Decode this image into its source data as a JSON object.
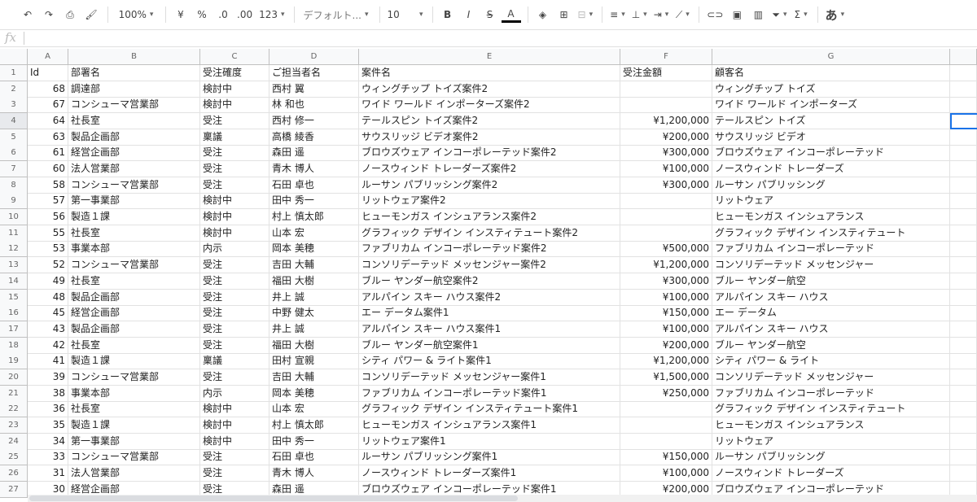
{
  "toolbar": {
    "zoom": "100%",
    "currency": "¥",
    "percent": "%",
    "dec_less": ".0",
    "dec_more": ".00",
    "format": "123",
    "font": "デフォルト...",
    "size": "10",
    "bold": "B",
    "italic": "I",
    "strike": "S",
    "textcolor": "A",
    "ime": "あ",
    "sum": "Σ"
  },
  "formula": {
    "fx": "fx",
    "value": ""
  },
  "columns": [
    "A",
    "B",
    "C",
    "D",
    "E",
    "F",
    "G",
    ""
  ],
  "header": [
    "Id",
    "部署名",
    "受注確度",
    "ご担当者名",
    "案件名",
    "受注金額",
    "顧客名"
  ],
  "rows": [
    [
      "68",
      "調達部",
      "検討中",
      "西村 翼",
      "ウィングチップ トイズ案件2",
      "",
      "ウィングチップ トイズ"
    ],
    [
      "67",
      "コンシューマ営業部",
      "検討中",
      "林 和也",
      "ワイド ワールド インポーターズ案件2",
      "",
      "ワイド ワールド インポーターズ"
    ],
    [
      "64",
      "社長室",
      "受注",
      "西村 修一",
      "テールスピン トイズ案件2",
      "¥1,200,000",
      "テールスピン トイズ"
    ],
    [
      "63",
      "製品企画部",
      "稟議",
      "高橋 綾香",
      "サウスリッジ ビデオ案件2",
      "¥200,000",
      "サウスリッジ ビデオ"
    ],
    [
      "61",
      "経営企画部",
      "受注",
      "森田 遥",
      "ブロウズウェア インコーポレーテッド案件2",
      "¥300,000",
      "ブロウズウェア インコーポレーテッド"
    ],
    [
      "60",
      "法人営業部",
      "受注",
      "青木 博人",
      "ノースウィンド トレーダーズ案件2",
      "¥100,000",
      "ノースウィンド トレーダーズ"
    ],
    [
      "58",
      "コンシューマ営業部",
      "受注",
      "石田 卓也",
      "ルーサン パブリッシング案件2",
      "¥300,000",
      "ルーサン パブリッシング"
    ],
    [
      "57",
      "第一事業部",
      "検討中",
      "田中 秀一",
      "リットウェア案件2",
      "",
      "リットウェア"
    ],
    [
      "56",
      "製造１課",
      "検討中",
      "村上 慎太郎",
      "ヒューモンガス インシュアランス案件2",
      "",
      "ヒューモンガス インシュアランス"
    ],
    [
      "55",
      "社長室",
      "検討中",
      "山本 宏",
      "グラフィック デザイン インスティテュート案件2",
      "",
      "グラフィック デザイン インスティテュート"
    ],
    [
      "53",
      "事業本部",
      "内示",
      "岡本 美穂",
      "ファブリカム インコーポレーテッド案件2",
      "¥500,000",
      "ファブリカム インコーポレーテッド"
    ],
    [
      "52",
      "コンシューマ営業部",
      "受注",
      "吉田 大輔",
      "コンソリデーテッド メッセンジャー案件2",
      "¥1,200,000",
      "コンソリデーテッド メッセンジャー"
    ],
    [
      "49",
      "社長室",
      "受注",
      "福田 大樹",
      "ブルー ヤンダー航空案件2",
      "¥300,000",
      "ブルー ヤンダー航空"
    ],
    [
      "48",
      "製品企画部",
      "受注",
      "井上 誠",
      "アルパイン スキー ハウス案件2",
      "¥100,000",
      "アルパイン スキー ハウス"
    ],
    [
      "45",
      "経営企画部",
      "受注",
      "中野 健太",
      "エー データム案件1",
      "¥150,000",
      "エー データム"
    ],
    [
      "43",
      "製品企画部",
      "受注",
      "井上 誠",
      "アルパイン スキー ハウス案件1",
      "¥100,000",
      "アルパイン スキー ハウス"
    ],
    [
      "42",
      "社長室",
      "受注",
      "福田 大樹",
      "ブルー ヤンダー航空案件1",
      "¥200,000",
      "ブルー ヤンダー航空"
    ],
    [
      "41",
      "製造１課",
      "稟議",
      "田村 宣親",
      "シティ パワー & ライト案件1",
      "¥1,200,000",
      "シティ パワー & ライト"
    ],
    [
      "39",
      "コンシューマ営業部",
      "受注",
      "吉田 大輔",
      "コンソリデーテッド メッセンジャー案件1",
      "¥1,500,000",
      "コンソリデーテッド メッセンジャー"
    ],
    [
      "38",
      "事業本部",
      "内示",
      "岡本 美穂",
      "ファブリカム インコーポレーテッド案件1",
      "¥250,000",
      "ファブリカム インコーポレーテッド"
    ],
    [
      "36",
      "社長室",
      "検討中",
      "山本 宏",
      "グラフィック デザイン インスティテュート案件1",
      "",
      "グラフィック デザイン インスティテュート"
    ],
    [
      "35",
      "製造１課",
      "検討中",
      "村上 慎太郎",
      "ヒューモンガス インシュアランス案件1",
      "",
      "ヒューモンガス インシュアランス"
    ],
    [
      "34",
      "第一事業部",
      "検討中",
      "田中 秀一",
      "リットウェア案件1",
      "",
      "リットウェア"
    ],
    [
      "33",
      "コンシューマ営業部",
      "受注",
      "石田 卓也",
      "ルーサン パブリッシング案件1",
      "¥150,000",
      "ルーサン パブリッシング"
    ],
    [
      "31",
      "法人営業部",
      "受注",
      "青木 博人",
      "ノースウィンド トレーダーズ案件1",
      "¥100,000",
      "ノースウィンド トレーダーズ"
    ],
    [
      "30",
      "経営企画部",
      "受注",
      "森田 遥",
      "ブロウズウェア インコーポレーテッド案件1",
      "¥200,000",
      "ブロウズウェア インコーポレーテッド"
    ]
  ]
}
